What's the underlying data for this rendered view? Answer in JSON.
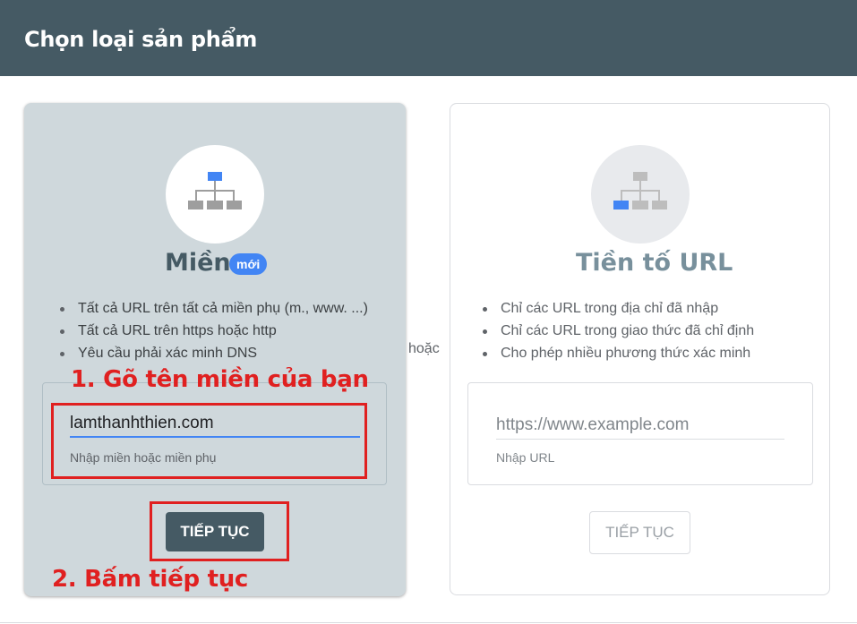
{
  "header": {
    "title": "Chọn loại sản phẩm"
  },
  "domain_card": {
    "icon": "sitemap-icon",
    "title": "Miền",
    "badge": "mới",
    "bullets": [
      "Tất cả URL trên tất cả miền phụ (m., www. ...)",
      "Tất cả URL trên https hoặc http",
      "Yêu cầu phải xác minh DNS"
    ],
    "input_value": "lamthanhthien.com",
    "input_hint": "Nhập miền hoặc miền phụ",
    "button_label": "TIẾP TỤC"
  },
  "separator": {
    "label": "hoặc"
  },
  "url_card": {
    "icon": "sitemap-icon",
    "title": "Tiền tố URL",
    "bullets": [
      "Chỉ các URL trong địa chỉ đã nhập",
      "Chỉ các URL trong giao thức đã chỉ định",
      "Cho phép nhiều phương thức xác minh"
    ],
    "input_placeholder": "https://www.example.com",
    "input_hint": "Nhập URL",
    "button_label": "TIẾP TỤC"
  },
  "annotations": {
    "step1": "1. Gõ tên miền của bạn",
    "step2": "2. Bấm tiếp tục",
    "color": "#e02020"
  },
  "colors": {
    "header_bg": "#455a64",
    "selected_card_bg": "#cfd8dc",
    "accent": "#4285f4"
  }
}
